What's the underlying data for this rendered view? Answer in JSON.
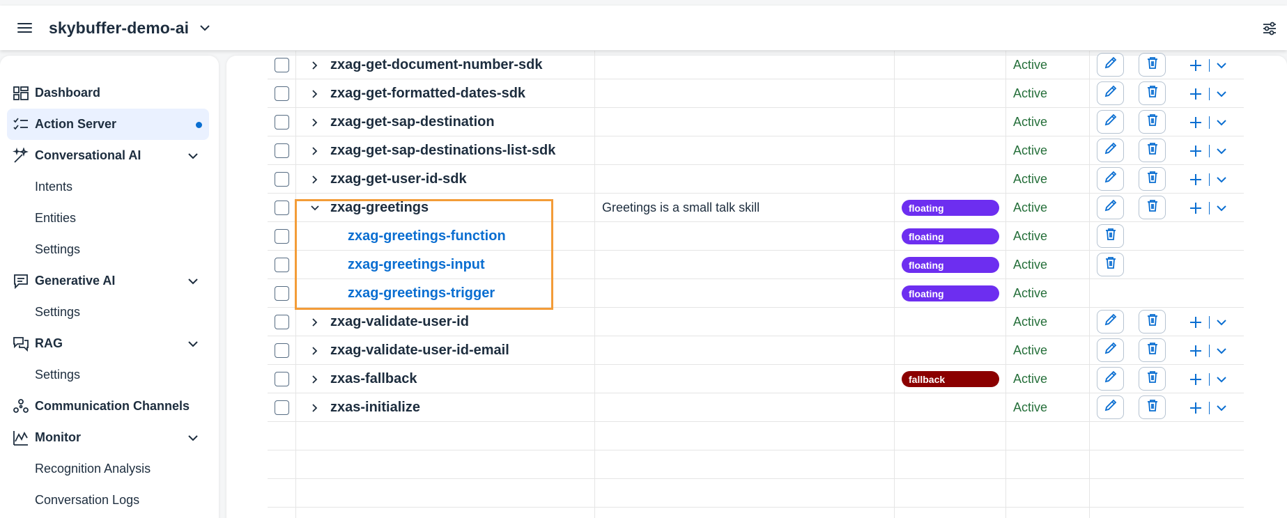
{
  "header": {
    "app_title": "skybuffer-demo-ai"
  },
  "sidebar": {
    "items": [
      {
        "label": "Dashboard"
      },
      {
        "label": "Action Server"
      },
      {
        "label": "Conversational AI"
      },
      {
        "label": "Intents"
      },
      {
        "label": "Entities"
      },
      {
        "label": "Settings"
      },
      {
        "label": "Generative AI"
      },
      {
        "label": "Settings"
      },
      {
        "label": "RAG"
      },
      {
        "label": "Settings"
      },
      {
        "label": "Communication Channels"
      },
      {
        "label": "Monitor"
      },
      {
        "label": "Recognition Analysis"
      },
      {
        "label": "Conversation Logs"
      }
    ]
  },
  "table": {
    "rows": [
      {
        "name": "zxag-get-document-number-sdk",
        "description": "",
        "tag": "",
        "status": "Active"
      },
      {
        "name": "zxag-get-formatted-dates-sdk",
        "description": "",
        "tag": "",
        "status": "Active"
      },
      {
        "name": "zxag-get-sap-destination",
        "description": "",
        "tag": "",
        "status": "Active"
      },
      {
        "name": "zxag-get-sap-destinations-list-sdk",
        "description": "",
        "tag": "",
        "status": "Active"
      },
      {
        "name": "zxag-get-user-id-sdk",
        "description": "",
        "tag": "",
        "status": "Active"
      },
      {
        "name": "zxag-greetings",
        "description": "Greetings is a small talk skill",
        "tag": "floating",
        "status": "Active"
      },
      {
        "name": "zxag-greetings-function",
        "description": "",
        "tag": "floating",
        "status": "Active"
      },
      {
        "name": "zxag-greetings-input",
        "description": "",
        "tag": "floating",
        "status": "Active"
      },
      {
        "name": "zxag-greetings-trigger",
        "description": "",
        "tag": "floating",
        "status": "Active"
      },
      {
        "name": "zxag-validate-user-id",
        "description": "",
        "tag": "",
        "status": "Active"
      },
      {
        "name": "zxag-validate-user-id-email",
        "description": "",
        "tag": "",
        "status": "Active"
      },
      {
        "name": "zxas-fallback",
        "description": "",
        "tag": "fallback",
        "status": "Active"
      },
      {
        "name": "zxas-initialize",
        "description": "",
        "tag": "",
        "status": "Active"
      }
    ]
  },
  "colors": {
    "accent": "#0a6ed1",
    "floating_badge": "#6d2ef0",
    "fallback_badge": "#8b0000",
    "status_active": "#256f3a",
    "highlight_border": "#f39c38"
  }
}
